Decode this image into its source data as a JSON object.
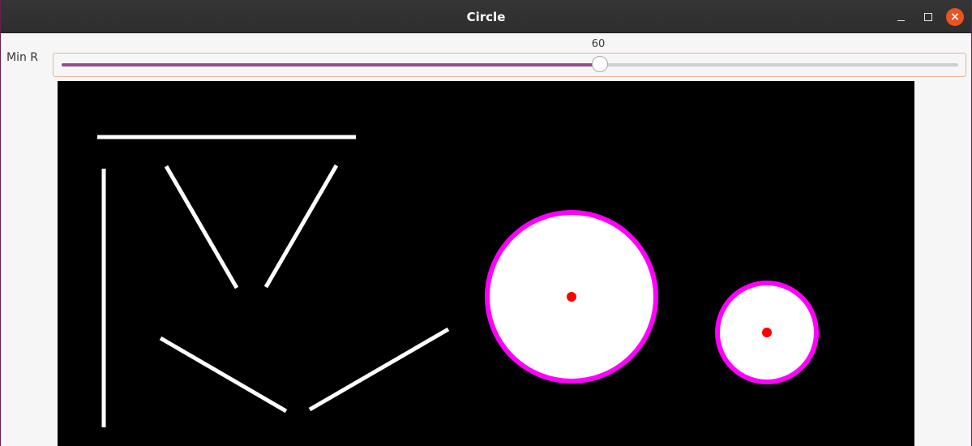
{
  "window": {
    "title": "Circle"
  },
  "controls": {
    "slider_label": "Min R",
    "slider_value": "60",
    "slider_fraction": 0.6
  },
  "colors": {
    "slider_fill": "#924d8b",
    "circle_outline": "#ff00ff",
    "circle_center": "#ff0000",
    "shape_fill": "#ffffff",
    "canvas_bg": "#000000",
    "close_button": "#e95420"
  },
  "icons": {
    "minimize": "minimize-icon",
    "maximize": "maximize-icon",
    "close": "close-icon"
  }
}
